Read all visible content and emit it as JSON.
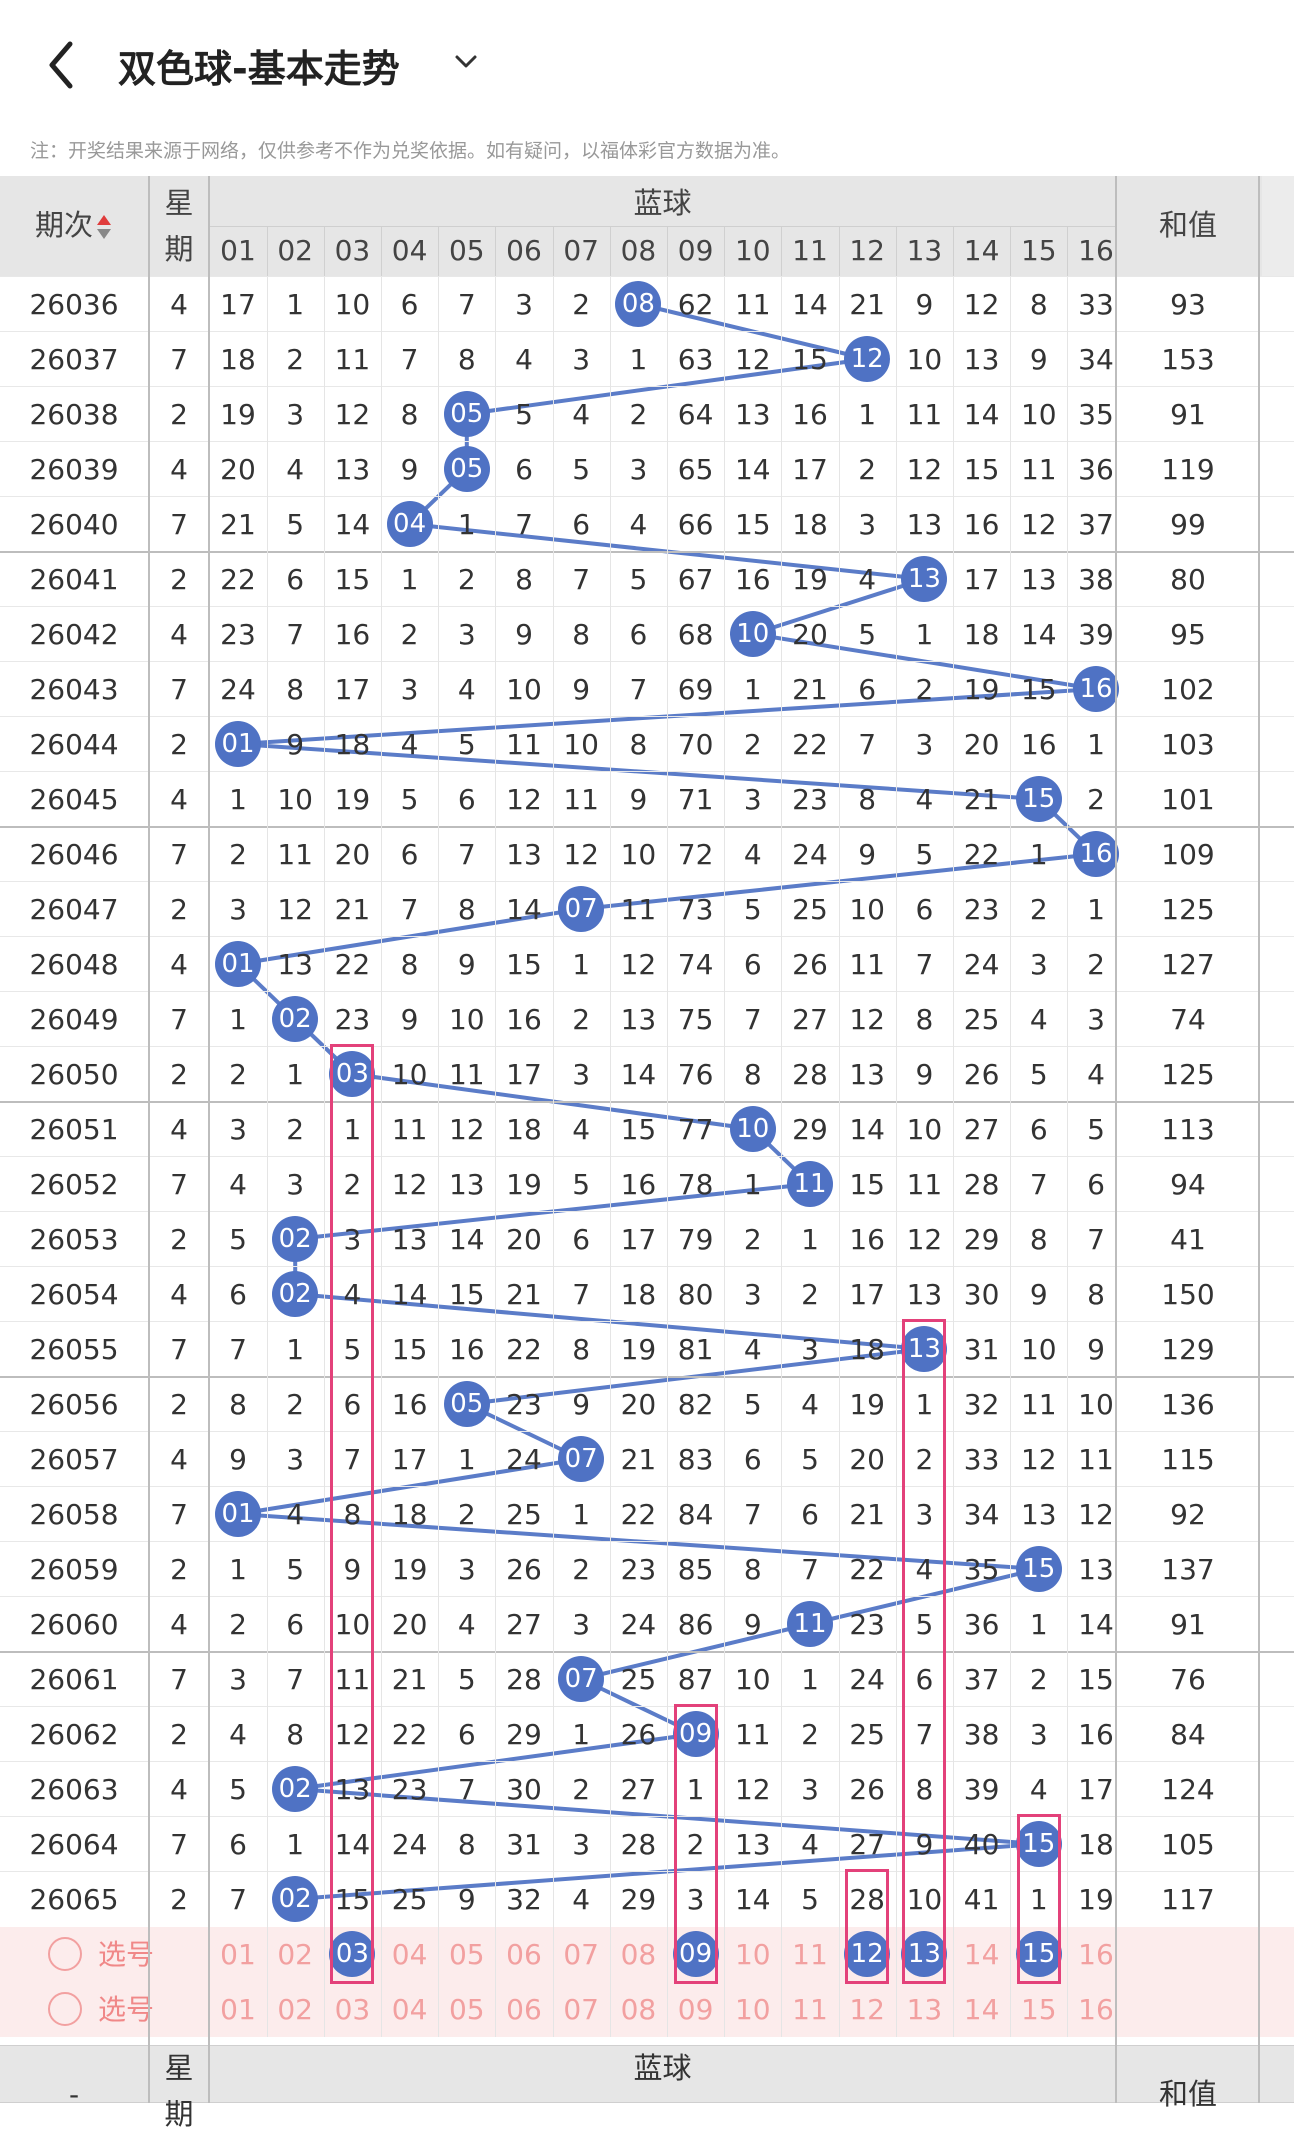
{
  "header": {
    "back_icon": "chevron-left-icon",
    "title": "双色球-基本走势",
    "dropdown_icon": "chevron-down-icon"
  },
  "notice": "注：开奖结果来源于网络，仅供参考不作为兑奖依据。如有疑问，以福体彩官方数据为准。",
  "table": {
    "col_issue": "期次",
    "col_week_1": "星",
    "col_week_2": "期",
    "col_blue": "蓝球",
    "col_sum": "和值",
    "blue_numbers": [
      "01",
      "02",
      "03",
      "04",
      "05",
      "06",
      "07",
      "08",
      "09",
      "10",
      "11",
      "12",
      "13",
      "14",
      "15",
      "16"
    ],
    "rows": [
      {
        "issue": "26036",
        "week": "4",
        "cells": [
          "17",
          "1",
          "10",
          "6",
          "7",
          "3",
          "2",
          "08",
          "62",
          "11",
          "14",
          "21",
          "9",
          "12",
          "8",
          "33"
        ],
        "sum": "93",
        "hit": 8
      },
      {
        "issue": "26037",
        "week": "7",
        "cells": [
          "18",
          "2",
          "11",
          "7",
          "8",
          "4",
          "3",
          "1",
          "63",
          "12",
          "15",
          "12",
          "10",
          "13",
          "9",
          "34"
        ],
        "sum": "153",
        "hit": 12
      },
      {
        "issue": "26038",
        "week": "2",
        "cells": [
          "19",
          "3",
          "12",
          "8",
          "05",
          "5",
          "4",
          "2",
          "64",
          "13",
          "16",
          "1",
          "11",
          "14",
          "10",
          "35"
        ],
        "sum": "91",
        "hit": 5
      },
      {
        "issue": "26039",
        "week": "4",
        "cells": [
          "20",
          "4",
          "13",
          "9",
          "05",
          "6",
          "5",
          "3",
          "65",
          "14",
          "17",
          "2",
          "12",
          "15",
          "11",
          "36"
        ],
        "sum": "119",
        "hit": 5
      },
      {
        "issue": "26040",
        "week": "7",
        "cells": [
          "21",
          "5",
          "14",
          "04",
          "1",
          "7",
          "6",
          "4",
          "66",
          "15",
          "18",
          "3",
          "13",
          "16",
          "12",
          "37"
        ],
        "sum": "99",
        "hit": 4
      },
      {
        "issue": "26041",
        "week": "2",
        "cells": [
          "22",
          "6",
          "15",
          "1",
          "2",
          "8",
          "7",
          "5",
          "67",
          "16",
          "19",
          "4",
          "13",
          "17",
          "13",
          "38"
        ],
        "sum": "80",
        "hit": 13
      },
      {
        "issue": "26042",
        "week": "4",
        "cells": [
          "23",
          "7",
          "16",
          "2",
          "3",
          "9",
          "8",
          "6",
          "68",
          "10",
          "20",
          "5",
          "1",
          "18",
          "14",
          "39"
        ],
        "sum": "95",
        "hit": 10
      },
      {
        "issue": "26043",
        "week": "7",
        "cells": [
          "24",
          "8",
          "17",
          "3",
          "4",
          "10",
          "9",
          "7",
          "69",
          "1",
          "21",
          "6",
          "2",
          "19",
          "15",
          "16"
        ],
        "sum": "102",
        "hit": 16
      },
      {
        "issue": "26044",
        "week": "2",
        "cells": [
          "01",
          "9",
          "18",
          "4",
          "5",
          "11",
          "10",
          "8",
          "70",
          "2",
          "22",
          "7",
          "3",
          "20",
          "16",
          "1"
        ],
        "sum": "103",
        "hit": 1
      },
      {
        "issue": "26045",
        "week": "4",
        "cells": [
          "1",
          "10",
          "19",
          "5",
          "6",
          "12",
          "11",
          "9",
          "71",
          "3",
          "23",
          "8",
          "4",
          "21",
          "15",
          "2"
        ],
        "sum": "101",
        "hit": 15
      },
      {
        "issue": "26046",
        "week": "7",
        "cells": [
          "2",
          "11",
          "20",
          "6",
          "7",
          "13",
          "12",
          "10",
          "72",
          "4",
          "24",
          "9",
          "5",
          "22",
          "1",
          "16"
        ],
        "sum": "109",
        "hit": 16
      },
      {
        "issue": "26047",
        "week": "2",
        "cells": [
          "3",
          "12",
          "21",
          "7",
          "8",
          "14",
          "07",
          "11",
          "73",
          "5",
          "25",
          "10",
          "6",
          "23",
          "2",
          "1"
        ],
        "sum": "125",
        "hit": 7
      },
      {
        "issue": "26048",
        "week": "4",
        "cells": [
          "01",
          "13",
          "22",
          "8",
          "9",
          "15",
          "1",
          "12",
          "74",
          "6",
          "26",
          "11",
          "7",
          "24",
          "3",
          "2"
        ],
        "sum": "127",
        "hit": 1
      },
      {
        "issue": "26049",
        "week": "7",
        "cells": [
          "1",
          "02",
          "23",
          "9",
          "10",
          "16",
          "2",
          "13",
          "75",
          "7",
          "27",
          "12",
          "8",
          "25",
          "4",
          "3"
        ],
        "sum": "74",
        "hit": 2
      },
      {
        "issue": "26050",
        "week": "2",
        "cells": [
          "2",
          "1",
          "03",
          "10",
          "11",
          "17",
          "3",
          "14",
          "76",
          "8",
          "28",
          "13",
          "9",
          "26",
          "5",
          "4"
        ],
        "sum": "125",
        "hit": 3
      },
      {
        "issue": "26051",
        "week": "4",
        "cells": [
          "3",
          "2",
          "1",
          "11",
          "12",
          "18",
          "4",
          "15",
          "77",
          "10",
          "29",
          "14",
          "10",
          "27",
          "6",
          "5"
        ],
        "sum": "113",
        "hit": 10
      },
      {
        "issue": "26052",
        "week": "7",
        "cells": [
          "4",
          "3",
          "2",
          "12",
          "13",
          "19",
          "5",
          "16",
          "78",
          "1",
          "11",
          "15",
          "11",
          "28",
          "7",
          "6"
        ],
        "sum": "94",
        "hit": 11
      },
      {
        "issue": "26053",
        "week": "2",
        "cells": [
          "5",
          "02",
          "3",
          "13",
          "14",
          "20",
          "6",
          "17",
          "79",
          "2",
          "1",
          "16",
          "12",
          "29",
          "8",
          "7"
        ],
        "sum": "41",
        "hit": 2
      },
      {
        "issue": "26054",
        "week": "4",
        "cells": [
          "6",
          "02",
          "4",
          "14",
          "15",
          "21",
          "7",
          "18",
          "80",
          "3",
          "2",
          "17",
          "13",
          "30",
          "9",
          "8"
        ],
        "sum": "150",
        "hit": 2
      },
      {
        "issue": "26055",
        "week": "7",
        "cells": [
          "7",
          "1",
          "5",
          "15",
          "16",
          "22",
          "8",
          "19",
          "81",
          "4",
          "3",
          "18",
          "13",
          "31",
          "10",
          "9"
        ],
        "sum": "129",
        "hit": 13
      },
      {
        "issue": "26056",
        "week": "2",
        "cells": [
          "8",
          "2",
          "6",
          "16",
          "05",
          "23",
          "9",
          "20",
          "82",
          "5",
          "4",
          "19",
          "1",
          "32",
          "11",
          "10"
        ],
        "sum": "136",
        "hit": 5
      },
      {
        "issue": "26057",
        "week": "4",
        "cells": [
          "9",
          "3",
          "7",
          "17",
          "1",
          "24",
          "07",
          "21",
          "83",
          "6",
          "5",
          "20",
          "2",
          "33",
          "12",
          "11"
        ],
        "sum": "115",
        "hit": 7
      },
      {
        "issue": "26058",
        "week": "7",
        "cells": [
          "01",
          "4",
          "8",
          "18",
          "2",
          "25",
          "1",
          "22",
          "84",
          "7",
          "6",
          "21",
          "3",
          "34",
          "13",
          "12"
        ],
        "sum": "92",
        "hit": 1
      },
      {
        "issue": "26059",
        "week": "2",
        "cells": [
          "1",
          "5",
          "9",
          "19",
          "3",
          "26",
          "2",
          "23",
          "85",
          "8",
          "7",
          "22",
          "4",
          "35",
          "15",
          "13"
        ],
        "sum": "137",
        "hit": 15
      },
      {
        "issue": "26060",
        "week": "4",
        "cells": [
          "2",
          "6",
          "10",
          "20",
          "4",
          "27",
          "3",
          "24",
          "86",
          "9",
          "11",
          "23",
          "5",
          "36",
          "1",
          "14"
        ],
        "sum": "91",
        "hit": 11
      },
      {
        "issue": "26061",
        "week": "7",
        "cells": [
          "3",
          "7",
          "11",
          "21",
          "5",
          "28",
          "07",
          "25",
          "87",
          "10",
          "1",
          "24",
          "6",
          "37",
          "2",
          "15"
        ],
        "sum": "76",
        "hit": 7
      },
      {
        "issue": "26062",
        "week": "2",
        "cells": [
          "4",
          "8",
          "12",
          "22",
          "6",
          "29",
          "1",
          "26",
          "09",
          "11",
          "2",
          "25",
          "7",
          "38",
          "3",
          "16"
        ],
        "sum": "84",
        "hit": 9
      },
      {
        "issue": "26063",
        "week": "4",
        "cells": [
          "5",
          "02",
          "13",
          "23",
          "7",
          "30",
          "2",
          "27",
          "1",
          "12",
          "3",
          "26",
          "8",
          "39",
          "4",
          "17"
        ],
        "sum": "124",
        "hit": 2
      },
      {
        "issue": "26064",
        "week": "7",
        "cells": [
          "6",
          "1",
          "14",
          "24",
          "8",
          "31",
          "3",
          "28",
          "2",
          "13",
          "4",
          "27",
          "9",
          "40",
          "15",
          "18"
        ],
        "sum": "105",
        "hit": 15
      },
      {
        "issue": "26065",
        "week": "2",
        "cells": [
          "7",
          "02",
          "15",
          "25",
          "9",
          "32",
          "4",
          "29",
          "3",
          "14",
          "5",
          "28",
          "10",
          "41",
          "1",
          "19"
        ],
        "sum": "117",
        "hit": 2
      }
    ],
    "select_label": "选号",
    "select_rows": [
      {
        "label": "选号",
        "balls": [
          3,
          9,
          12,
          13,
          15
        ]
      },
      {
        "label": "选号",
        "balls": []
      }
    ],
    "highlight_columns": [
      3,
      9,
      12,
      13,
      15
    ],
    "bottom_issue": "-",
    "bottom_week": "星",
    "bottom_week_2": "期",
    "bottom_blue": "蓝球",
    "bottom_sum": "和值"
  },
  "colors": {
    "ball": "#4f72c4",
    "line": "#5b7cc8",
    "highlight_box": "#e3417a",
    "select_text": "#f2a0a0",
    "select_bg": "#fcecec",
    "sort_up": "#e03c3c",
    "sort_down": "#888888"
  }
}
